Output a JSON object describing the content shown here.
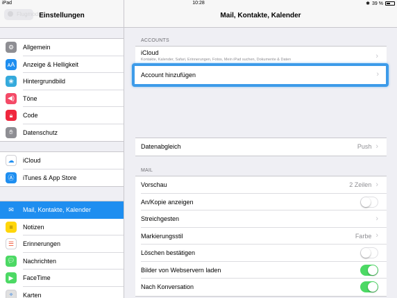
{
  "status": {
    "device": "iPad",
    "time": "10:28",
    "battery": "39 %",
    "battery_level": 0.39
  },
  "sidebar": {
    "title": "Einstellungen",
    "ghost_item": "Flugmodus",
    "group1": [
      {
        "label": "Allgemein",
        "icon": "gear-icon",
        "color": "#8e8e93"
      },
      {
        "label": "Anzeige & Helligkeit",
        "icon": "text-size-icon",
        "color": "#1e8ef0"
      },
      {
        "label": "Hintergrundbild",
        "icon": "flower-icon",
        "color": "#35aadc"
      },
      {
        "label": "Töne",
        "icon": "speaker-icon",
        "color": "#f44a67"
      },
      {
        "label": "Code",
        "icon": "lock-icon",
        "color": "#f0263d"
      },
      {
        "label": "Datenschutz",
        "icon": "hand-icon",
        "color": "#8e8e93"
      }
    ],
    "group2": [
      {
        "label": "iCloud",
        "icon": "cloud-icon",
        "color": "#ffffff"
      },
      {
        "label": "iTunes & App Store",
        "icon": "app-store-icon",
        "color": "#1e8ef0"
      }
    ],
    "group3": [
      {
        "label": "Mail, Kontakte, Kalender",
        "icon": "mail-icon",
        "color": "#1e8ef0",
        "selected": true
      },
      {
        "label": "Notizen",
        "icon": "notes-icon",
        "color": "#ffd60a"
      },
      {
        "label": "Erinnerungen",
        "icon": "list-icon",
        "color": "#ffffff"
      },
      {
        "label": "Nachrichten",
        "icon": "message-icon",
        "color": "#4cd964"
      },
      {
        "label": "FaceTime",
        "icon": "video-icon",
        "color": "#4cd964"
      },
      {
        "label": "Karten",
        "icon": "map-icon",
        "color": "#e0e0e0"
      }
    ]
  },
  "main": {
    "title": "Mail, Kontakte, Kalender",
    "accounts_header": "ACCOUNTS",
    "icloud_label": "iCloud",
    "icloud_sub": "Kontakte, Kalender, Safari, Erinnerungen, Fotos, Mein iPad suchen, Dokumente & Daten",
    "add_account": "Account hinzufügen",
    "fetch": {
      "label": "Datenabgleich",
      "value": "Push"
    },
    "mail_header": "MAIL",
    "mail_rows": [
      {
        "label": "Vorschau",
        "value": "2 Zeilen",
        "kind": "chevron"
      },
      {
        "label": "An/Kopie anzeigen",
        "kind": "toggle",
        "on": false
      },
      {
        "label": "Streichgesten",
        "kind": "chevron",
        "value": ""
      },
      {
        "label": "Markierungsstil",
        "value": "Farbe",
        "kind": "chevron"
      },
      {
        "label": "Löschen bestätigen",
        "kind": "toggle",
        "on": false
      },
      {
        "label": "Bilder von Webservern laden",
        "kind": "toggle",
        "on": true
      },
      {
        "label": "Nach Konversation",
        "kind": "toggle",
        "on": true
      }
    ]
  }
}
